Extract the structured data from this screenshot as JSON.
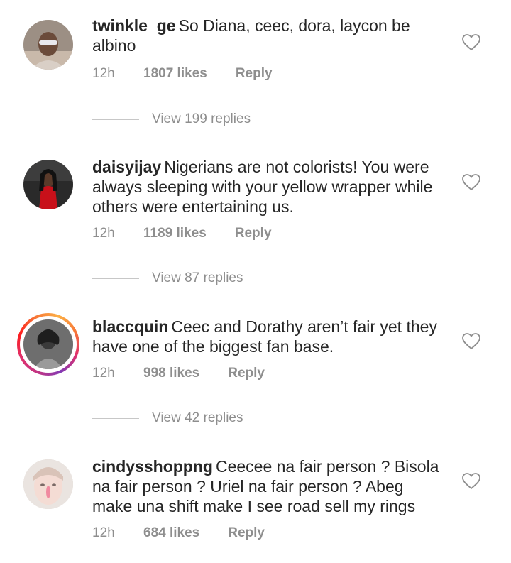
{
  "comments": [
    {
      "username": "twinkle_ge",
      "text": "So Diana, ceec, dora, laycon be albino",
      "time": "12h",
      "likes": "1807 likes",
      "reply": "Reply",
      "view_replies": "View 199 replies",
      "story_ring": false
    },
    {
      "username": "daisyijay",
      "text": "Nigerians are not colorists! You were always sleeping with your yellow wrapper while others were entertaining us.",
      "time": "12h",
      "likes": "1189 likes",
      "reply": "Reply",
      "view_replies": "View 87 replies",
      "story_ring": false
    },
    {
      "username": "blaccquin",
      "text": "Ceec and Dorathy aren’t fair yet they have one of the biggest fan base.",
      "time": "12h",
      "likes": "998 likes",
      "reply": "Reply",
      "view_replies": "View 42 replies",
      "story_ring": true
    },
    {
      "username": "cindysshoppng",
      "text": "Ceecee na fair person ? Bisola na fair person ? Uriel na fair person ? Abeg make una shift make I see road sell my rings",
      "time": "12h",
      "likes": "684 likes",
      "reply": "Reply",
      "story_ring": false
    }
  ],
  "icons": {
    "like": "heart-outline-icon"
  },
  "colors": {
    "text": "#262626",
    "secondary": "#8e8e8e",
    "divider": "#c7c7c7"
  }
}
